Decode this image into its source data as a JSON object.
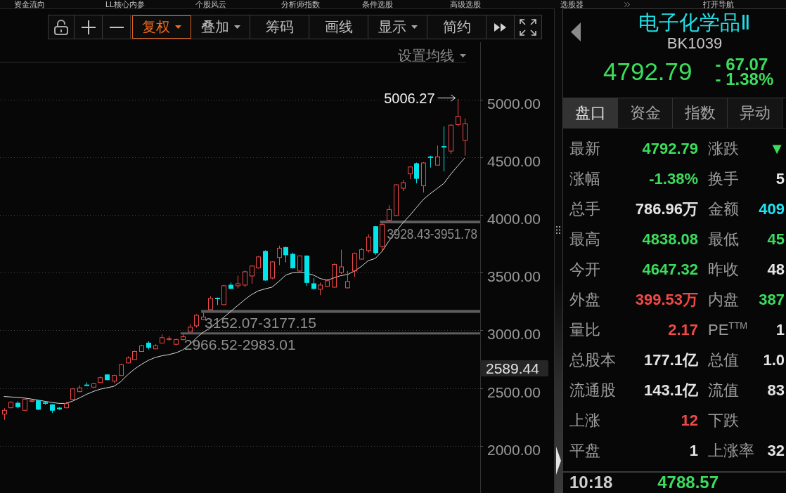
{
  "menu_bar": {
    "items": [
      "资金流向",
      "LL核心内参",
      "个股风云",
      "分析师指数",
      "条件选股",
      "高级选股",
      "选股器",
      "打开导航"
    ]
  },
  "toolbar": {
    "buttons": [
      {
        "label": "复权",
        "dropdown": true,
        "selected": true
      },
      {
        "label": "叠加",
        "dropdown": true,
        "selected": false
      },
      {
        "label": "筹码",
        "dropdown": false,
        "selected": false
      },
      {
        "label": "画线",
        "dropdown": false,
        "selected": false
      },
      {
        "label": "显示",
        "dropdown": true,
        "selected": false
      },
      {
        "label": "简约",
        "dropdown": false,
        "selected": false
      }
    ]
  },
  "chart": {
    "settings_button": {
      "label": "设置均线",
      "dropdown": true
    },
    "axis_marker": "2589.44",
    "chart_data": [
      {
        "type": "candlestick",
        "ohlc": [
          [
            2274,
            2325,
            2225,
            2307
          ],
          [
            2329,
            2385,
            2325,
            2377
          ],
          [
            2369,
            2385,
            2325,
            2337
          ],
          [
            2307,
            2415,
            2305,
            2404
          ],
          [
            2385,
            2400,
            2375,
            2393
          ],
          [
            2390,
            2395,
            2310,
            2316
          ],
          [
            2373,
            2385,
            2355,
            2369
          ],
          [
            2356,
            2360,
            2285,
            2307
          ],
          [
            2327,
            2335,
            2310,
            2319
          ],
          [
            2329,
            2380,
            2325,
            2365
          ],
          [
            2402,
            2500,
            2400,
            2493
          ],
          [
            2469,
            2525,
            2465,
            2502
          ],
          [
            2527,
            2550,
            2520,
            2523
          ],
          [
            2508,
            2543,
            2505,
            2537
          ],
          [
            2548,
            2600,
            2545,
            2590
          ],
          [
            2615,
            2620,
            2568,
            2572
          ],
          [
            2560,
            2615,
            2545,
            2609
          ],
          [
            2609,
            2710,
            2607,
            2703
          ],
          [
            2718,
            2775,
            2715,
            2761
          ],
          [
            2748,
            2825,
            2745,
            2817
          ],
          [
            2817,
            2875,
            2815,
            2866
          ],
          [
            2890,
            2905,
            2835,
            2852
          ],
          [
            2840,
            2880,
            2837,
            2866
          ],
          [
            2890,
            2965,
            2887,
            2937
          ],
          [
            2923,
            2950,
            2910,
            2928
          ],
          [
            2880,
            2930,
            2870,
            2920
          ],
          [
            2920,
            2966.52,
            2915,
            2945
          ],
          [
            2986,
            3055,
            2983.01,
            3028
          ],
          [
            3040,
            3140,
            3025,
            3131
          ],
          [
            3095,
            3152.07,
            3090,
            3116
          ],
          [
            3180,
            3295,
            3177.15,
            3278
          ],
          [
            3280,
            3285,
            3220,
            3275
          ],
          [
            3223,
            3395,
            3220,
            3387
          ],
          [
            3393,
            3415,
            3360,
            3363
          ],
          [
            3387,
            3475,
            3365,
            3405
          ],
          [
            3393,
            3520,
            3375,
            3509
          ],
          [
            3472,
            3565,
            3405,
            3558
          ],
          [
            3542,
            3645,
            3535,
            3637
          ],
          [
            3686,
            3695,
            3430,
            3436
          ],
          [
            3454,
            3600,
            3445,
            3594
          ],
          [
            3632,
            3735,
            3565,
            3713
          ],
          [
            3719,
            3725,
            3590,
            3655
          ],
          [
            3661,
            3675,
            3535,
            3542
          ],
          [
            3515,
            3650,
            3510,
            3646
          ],
          [
            3646,
            3650,
            3385,
            3415
          ],
          [
            3405,
            3455,
            3355,
            3363
          ],
          [
            3357,
            3415,
            3305,
            3393
          ],
          [
            3381,
            3445,
            3375,
            3430
          ],
          [
            3375,
            3580,
            3370,
            3572
          ],
          [
            3503,
            3700,
            3490,
            3551
          ],
          [
            3369,
            3515,
            3365,
            3424
          ],
          [
            3515,
            3675,
            3465,
            3667
          ],
          [
            3618,
            3715,
            3615,
            3700
          ],
          [
            3692,
            3835,
            3675,
            3809
          ],
          [
            3900,
            3905,
            3655,
            3673
          ],
          [
            3728,
            3928.43,
            3679,
            3920
          ],
          [
            3955,
            4085,
            3951.78,
            4048
          ],
          [
            3996,
            4270,
            3990,
            4263
          ],
          [
            4233,
            4305,
            4208,
            4281
          ],
          [
            4357,
            4425,
            4311,
            4417
          ],
          [
            4446,
            4455,
            4275,
            4318
          ],
          [
            4254,
            4460,
            4195,
            4452
          ],
          [
            4505,
            4515,
            4412,
            4500
          ],
          [
            4433,
            4603,
            4430,
            4506
          ],
          [
            4595,
            4770,
            4379,
            4589
          ],
          [
            4555,
            4785,
            4530,
            4780
          ],
          [
            4784,
            5006.27,
            4770,
            4857
          ],
          [
            4647.32,
            4838.08,
            4515,
            4792.79
          ]
        ],
        "series": [
          {
            "type": "line",
            "color": "#dcdcdc",
            "values": [
              2427,
              2423,
              2419,
              2413,
              2405,
              2395,
              2385,
              2375,
              2367,
              2367,
              2387,
              2415,
              2445,
              2470,
              2490,
              2503,
              2515,
              2555,
              2615,
              2665,
              2705,
              2740,
              2765,
              2780,
              2790,
              2805,
              2830,
              2875,
              2935,
              2985,
              3020,
              3070,
              3115,
              3165,
              3215,
              3265,
              3310,
              3343,
              3360,
              3375,
              3425,
              3480,
              3500,
              3503,
              3497,
              3480,
              3450,
              3435,
              3455,
              3475,
              3485,
              3515,
              3555,
              3605,
              3623,
              3685,
              3775,
              3855,
              3930,
              3995,
              4065,
              4135,
              4185,
              4230,
              4275,
              4355,
              4425,
              4494
            ]
          }
        ],
        "ylim": [
          1590,
          5317
        ],
        "yticks": [
          {
            "value": 5000,
            "label": "5000.00"
          },
          {
            "value": 4500,
            "label": "4500.00"
          },
          {
            "value": 4000,
            "label": "4000.00"
          },
          {
            "value": 3500,
            "label": "3500.00"
          },
          {
            "value": 3000,
            "label": "3000.00"
          },
          {
            "value": 2500,
            "label": "2500.00"
          },
          {
            "value": 2000,
            "label": "2000.00"
          }
        ],
        "tick_labels": "y",
        "grid": true,
        "bands": [
          {
            "axis": "y",
            "from": 3928.43,
            "to": 3951.78,
            "label": "3928.43-3951.78",
            "color": "#5e5e5e"
          },
          {
            "axis": "y",
            "from": 3152.07,
            "to": 3177.15,
            "label": "3152.07-3177.15",
            "color": "#5e5e5e"
          },
          {
            "axis": "y",
            "from": 2966.52,
            "to": 2983.01,
            "label": "2966.52-2983.01",
            "color": "#5e5e5e"
          }
        ],
        "annotations": [
          "5006.27"
        ]
      }
    ]
  },
  "quote": {
    "name": "电子化学品Ⅱ",
    "code": "BK1039",
    "price": "4792.79",
    "change": "- 67.07",
    "change_pct": "- 1.38%",
    "color": "#3cdc5c"
  },
  "panel_tabs": [
    {
      "label": "盘口",
      "selected": true
    },
    {
      "label": "资金",
      "selected": false
    },
    {
      "label": "指数",
      "selected": false
    },
    {
      "label": "异动",
      "selected": false
    }
  ],
  "stats": [
    {
      "left": {
        "label": "最新",
        "value": "4792.79",
        "color": "#3cdc5c"
      },
      "right": {
        "label": "涨跌",
        "value": "▼",
        "color": "#3cdc5c"
      }
    },
    {
      "left": {
        "label": "涨幅",
        "value": "-1.38%",
        "color": "#3cdc5c"
      },
      "right": {
        "label": "换手",
        "value": "5",
        "color": "#e4e4e4"
      }
    },
    {
      "left": {
        "label": "总手",
        "value": "786.96万",
        "color": "#e4e4e4"
      },
      "right": {
        "label": "金额",
        "value": "409",
        "color": "#1ee4f4"
      }
    },
    {
      "left": {
        "label": "最高",
        "value": "4838.08",
        "color": "#3cdc5c"
      },
      "right": {
        "label": "最低",
        "value": "45",
        "color": "#3cdc5c"
      }
    },
    {
      "left": {
        "label": "今开",
        "value": "4647.32",
        "color": "#3cdc5c"
      },
      "right": {
        "label": "昨收",
        "value": "48",
        "color": "#e4e4e4"
      }
    },
    {
      "left": {
        "label": "外盘",
        "value": "399.53万",
        "color": "#f24848"
      },
      "right": {
        "label": "内盘",
        "value": "387",
        "color": "#3cdc5c"
      }
    },
    {
      "left": {
        "label": "量比",
        "value": "2.17",
        "color": "#f24848"
      },
      "right": {
        "label": "PE$^{TTM}$",
        "value": "1",
        "color": "#e4e4e4"
      }
    },
    {
      "left": {
        "label": "总股本",
        "value": "177.1亿",
        "color": "#e4e4e4"
      },
      "right": {
        "label": "总值",
        "value": "1.0",
        "color": "#e4e4e4"
      }
    },
    {
      "left": {
        "label": "流通股",
        "value": "143.1亿",
        "color": "#e4e4e4"
      },
      "right": {
        "label": "流值",
        "value": "83",
        "color": "#e4e4e4"
      }
    },
    {
      "left": {
        "label": "上涨",
        "value": "12",
        "color": "#f24848"
      },
      "right": {
        "label": "下跌"
      }
    },
    {
      "left": {
        "label": "平盘",
        "value": "1",
        "color": "#e4e4e4"
      },
      "right": {
        "label": "上涨率",
        "value": "32",
        "color": "#e4e4e4"
      }
    }
  ],
  "trades": [
    {
      "time": "10:18",
      "price": "4788.57",
      "color": "#3cdc5c"
    }
  ]
}
